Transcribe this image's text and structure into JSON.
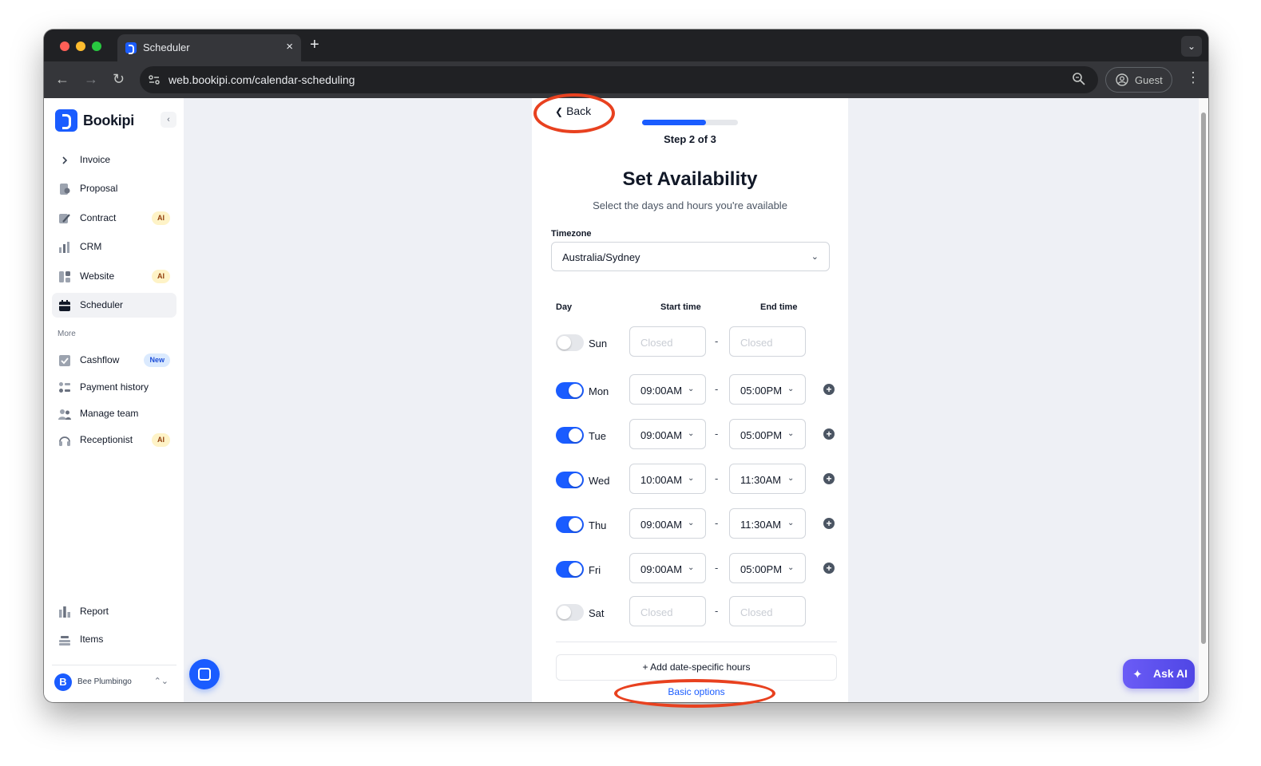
{
  "browser": {
    "tab_title": "Scheduler",
    "tab_close": "×",
    "new_tab": "+",
    "tab_menu": "⌄",
    "url": "web.bookipi.com/calendar-scheduling",
    "profile_label": "Guest",
    "back": "←",
    "forward": "→",
    "reload": "↻",
    "menu": "⋮"
  },
  "sidebar": {
    "brand": "Bookipi",
    "collapse": "‹",
    "primary_items": [
      {
        "label": "Invoice",
        "icon": "chevron-right-icon"
      },
      {
        "label": "Proposal",
        "icon": "proposal-icon"
      },
      {
        "label": "Contract",
        "icon": "contract-icon",
        "badge": "AI"
      },
      {
        "label": "CRM",
        "icon": "crm-icon"
      },
      {
        "label": "Website",
        "icon": "website-icon",
        "badge": "AI"
      },
      {
        "label": "Scheduler",
        "icon": "calendar-icon",
        "active": true
      }
    ],
    "more_label": "More",
    "more_items": [
      {
        "label": "Cashflow",
        "icon": "cashflow-icon",
        "badge": "New"
      },
      {
        "label": "Payment history",
        "icon": "payment-history-icon"
      },
      {
        "label": "Manage team",
        "icon": "team-icon"
      },
      {
        "label": "Receptionist",
        "icon": "headset-icon",
        "badge": "AI"
      }
    ],
    "bottom_items": [
      {
        "label": "Report",
        "icon": "report-icon"
      },
      {
        "label": "Items",
        "icon": "items-icon"
      }
    ],
    "user": {
      "initial": "B",
      "name": "Bee Plumbingo",
      "switch": "⌃⌄"
    }
  },
  "wizard": {
    "back_label": "Back",
    "progress": 0.67,
    "step_label": "Step 2 of 3",
    "title": "Set Availability",
    "subtitle": "Select the days and hours you're available",
    "timezone_label": "Timezone",
    "timezone_value": "Australia/Sydney",
    "col_day": "Day",
    "col_start": "Start time",
    "col_end": "End time",
    "days": [
      {
        "day": "Sun",
        "enabled": false,
        "start": "Closed",
        "end": "Closed"
      },
      {
        "day": "Mon",
        "enabled": true,
        "start": "09:00AM",
        "end": "05:00PM"
      },
      {
        "day": "Tue",
        "enabled": true,
        "start": "09:00AM",
        "end": "05:00PM"
      },
      {
        "day": "Wed",
        "enabled": true,
        "start": "10:00AM",
        "end": "11:30AM"
      },
      {
        "day": "Thu",
        "enabled": true,
        "start": "09:00AM",
        "end": "11:30AM"
      },
      {
        "day": "Fri",
        "enabled": true,
        "start": "09:00AM",
        "end": "05:00PM"
      },
      {
        "day": "Sat",
        "enabled": false,
        "start": "Closed",
        "end": "Closed"
      }
    ],
    "dash": "-",
    "add_hours_label": "+ Add date-specific hours",
    "basic_options_label": "Basic options"
  },
  "ask_ai_label": "Ask AI",
  "annotation_color": "#e8411f",
  "accent_color": "#1a5cff"
}
